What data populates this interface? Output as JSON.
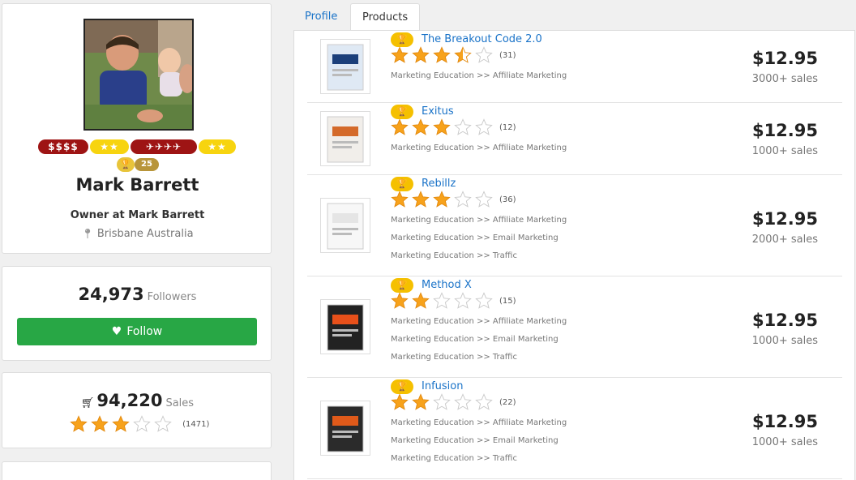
{
  "profile": {
    "name": "Mark Barrett",
    "role": "Owner at Mark Barrett",
    "location": "Brisbane Australia",
    "badges": [
      "$$$$",
      "★★",
      "✈✈✈✈",
      "★★"
    ],
    "trophy_count": "25"
  },
  "followers": {
    "count": "24,973",
    "label": "Followers",
    "button_label": "Follow"
  },
  "sales": {
    "count": "94,220",
    "label": "Sales",
    "rating_count": "(1471)",
    "rating": 3
  },
  "tabs": [
    {
      "label": "Profile"
    },
    {
      "label": "Products"
    }
  ],
  "products": [
    {
      "title": "The Breakout Code 2.0",
      "rating": 3.5,
      "rating_count": "(31)",
      "categories": [
        "Marketing Education >> Affiliate Marketing"
      ],
      "price": "$12.95",
      "sales": "3000+ sales"
    },
    {
      "title": "Exitus",
      "rating": 3,
      "rating_count": "(12)",
      "categories": [
        "Marketing Education >> Affiliate Marketing"
      ],
      "price": "$12.95",
      "sales": "1000+ sales"
    },
    {
      "title": "Rebillz",
      "rating": 3,
      "rating_count": "(36)",
      "categories": [
        "Marketing Education >> Affiliate Marketing",
        "Marketing Education >> Email Marketing",
        "Marketing Education >> Traffic"
      ],
      "price": "$12.95",
      "sales": "2000+ sales"
    },
    {
      "title": "Method X",
      "rating": 2,
      "rating_count": "(15)",
      "categories": [
        "Marketing Education >> Affiliate Marketing",
        "Marketing Education >> Email Marketing",
        "Marketing Education >> Traffic"
      ],
      "price": "$12.95",
      "sales": "1000+ sales"
    },
    {
      "title": "Infusion",
      "rating": 2,
      "rating_count": "(22)",
      "categories": [
        "Marketing Education >> Affiliate Marketing",
        "Marketing Education >> Email Marketing",
        "Marketing Education >> Traffic"
      ],
      "price": "$12.95",
      "sales": "1000+ sales"
    }
  ],
  "colors": {
    "link": "#1a73c8",
    "follow_button": "#28a745",
    "badge_red": "#9e1414",
    "badge_yellow": "#f7d40f",
    "star": "#f7a21b"
  }
}
